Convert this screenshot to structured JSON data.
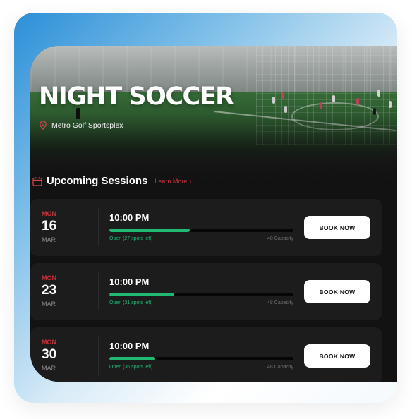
{
  "event": {
    "title": "NIGHT SOCCER",
    "venue": "Metro Golf Sportsplex"
  },
  "section": {
    "title": "Upcoming Sessions",
    "learn_more": "Learn More ↓"
  },
  "sessions": [
    {
      "day": "MON",
      "date": "16",
      "month": "MAR",
      "time": "10:00 PM",
      "status": "Open (27 spots left)",
      "capacity": "48 Capacity",
      "filled_fraction": 0.4375,
      "button": "BOOK NOW"
    },
    {
      "day": "MON",
      "date": "23",
      "month": "MAR",
      "time": "10:00 PM",
      "status": "Open (31 spots left)",
      "capacity": "48 Capacity",
      "filled_fraction": 0.354,
      "button": "BOOK NOW"
    },
    {
      "day": "MON",
      "date": "30",
      "month": "MAR",
      "time": "10:00 PM",
      "status": "Open (36 spots left)",
      "capacity": "48 Capacity",
      "filled_fraction": 0.25,
      "button": "BOOK NOW"
    }
  ],
  "colors": {
    "accent_red": "#c7333a",
    "progress_green": "#1fb971",
    "card_bg": "#121212"
  }
}
